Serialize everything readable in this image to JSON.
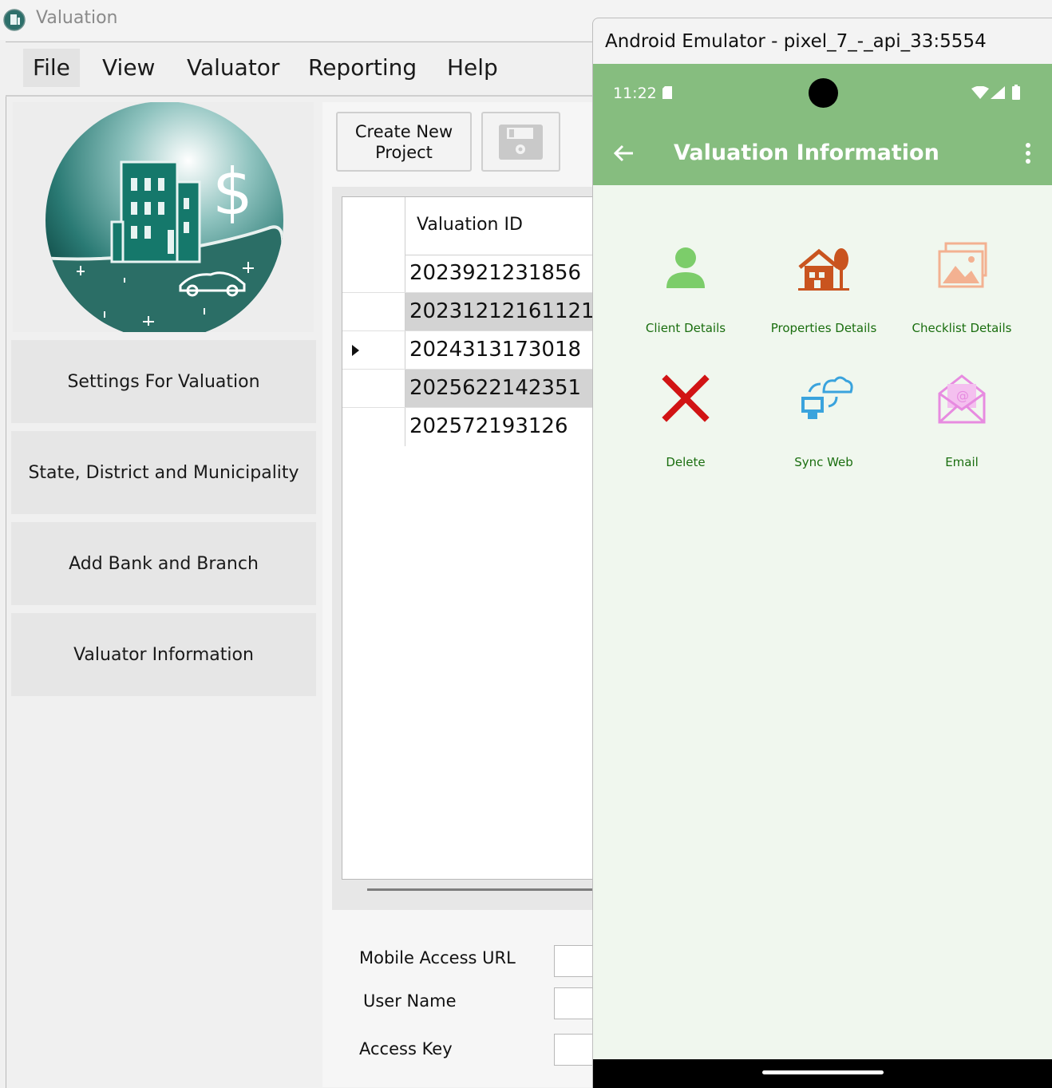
{
  "app": {
    "title": "Valuation"
  },
  "menu": {
    "items": [
      "File",
      "View",
      "Valuator",
      "Reporting",
      "Help"
    ]
  },
  "sidebar": {
    "buttons": [
      "Settings For Valuation",
      "State, District and Municipality",
      "Add Bank and Branch",
      "Valuator Information"
    ]
  },
  "toolbar": {
    "create_label": "Create New\nProject",
    "save_icon": "floppy-disk-icon"
  },
  "grid": {
    "column_header": "Valuation ID",
    "rows": [
      "2023921231856",
      "20231212161121",
      "2024313173018",
      "2025622142351",
      "202572193126"
    ],
    "current_row_index": 2
  },
  "form": {
    "labels": [
      "Mobile Access URL",
      "User Name",
      "Access Key"
    ]
  },
  "emulator": {
    "window_title": "Android Emulator - pixel_7_-_api_33:5554",
    "status_time": "11:22",
    "appbar_title": "Valuation Information",
    "tiles": [
      {
        "label": "Client Details",
        "icon": "person-icon"
      },
      {
        "label": "Properties Details",
        "icon": "house-icon"
      },
      {
        "label": "Checklist Details",
        "icon": "image-gallery-icon"
      },
      {
        "label": "Delete",
        "icon": "delete-x-icon"
      },
      {
        "label": "Sync Web",
        "icon": "cloud-sync-icon"
      },
      {
        "label": "Email",
        "icon": "email-icon"
      }
    ],
    "colors": {
      "appbar": "#86bd7f",
      "label": "#1a6e0f",
      "background": "#f0f7ee"
    }
  }
}
